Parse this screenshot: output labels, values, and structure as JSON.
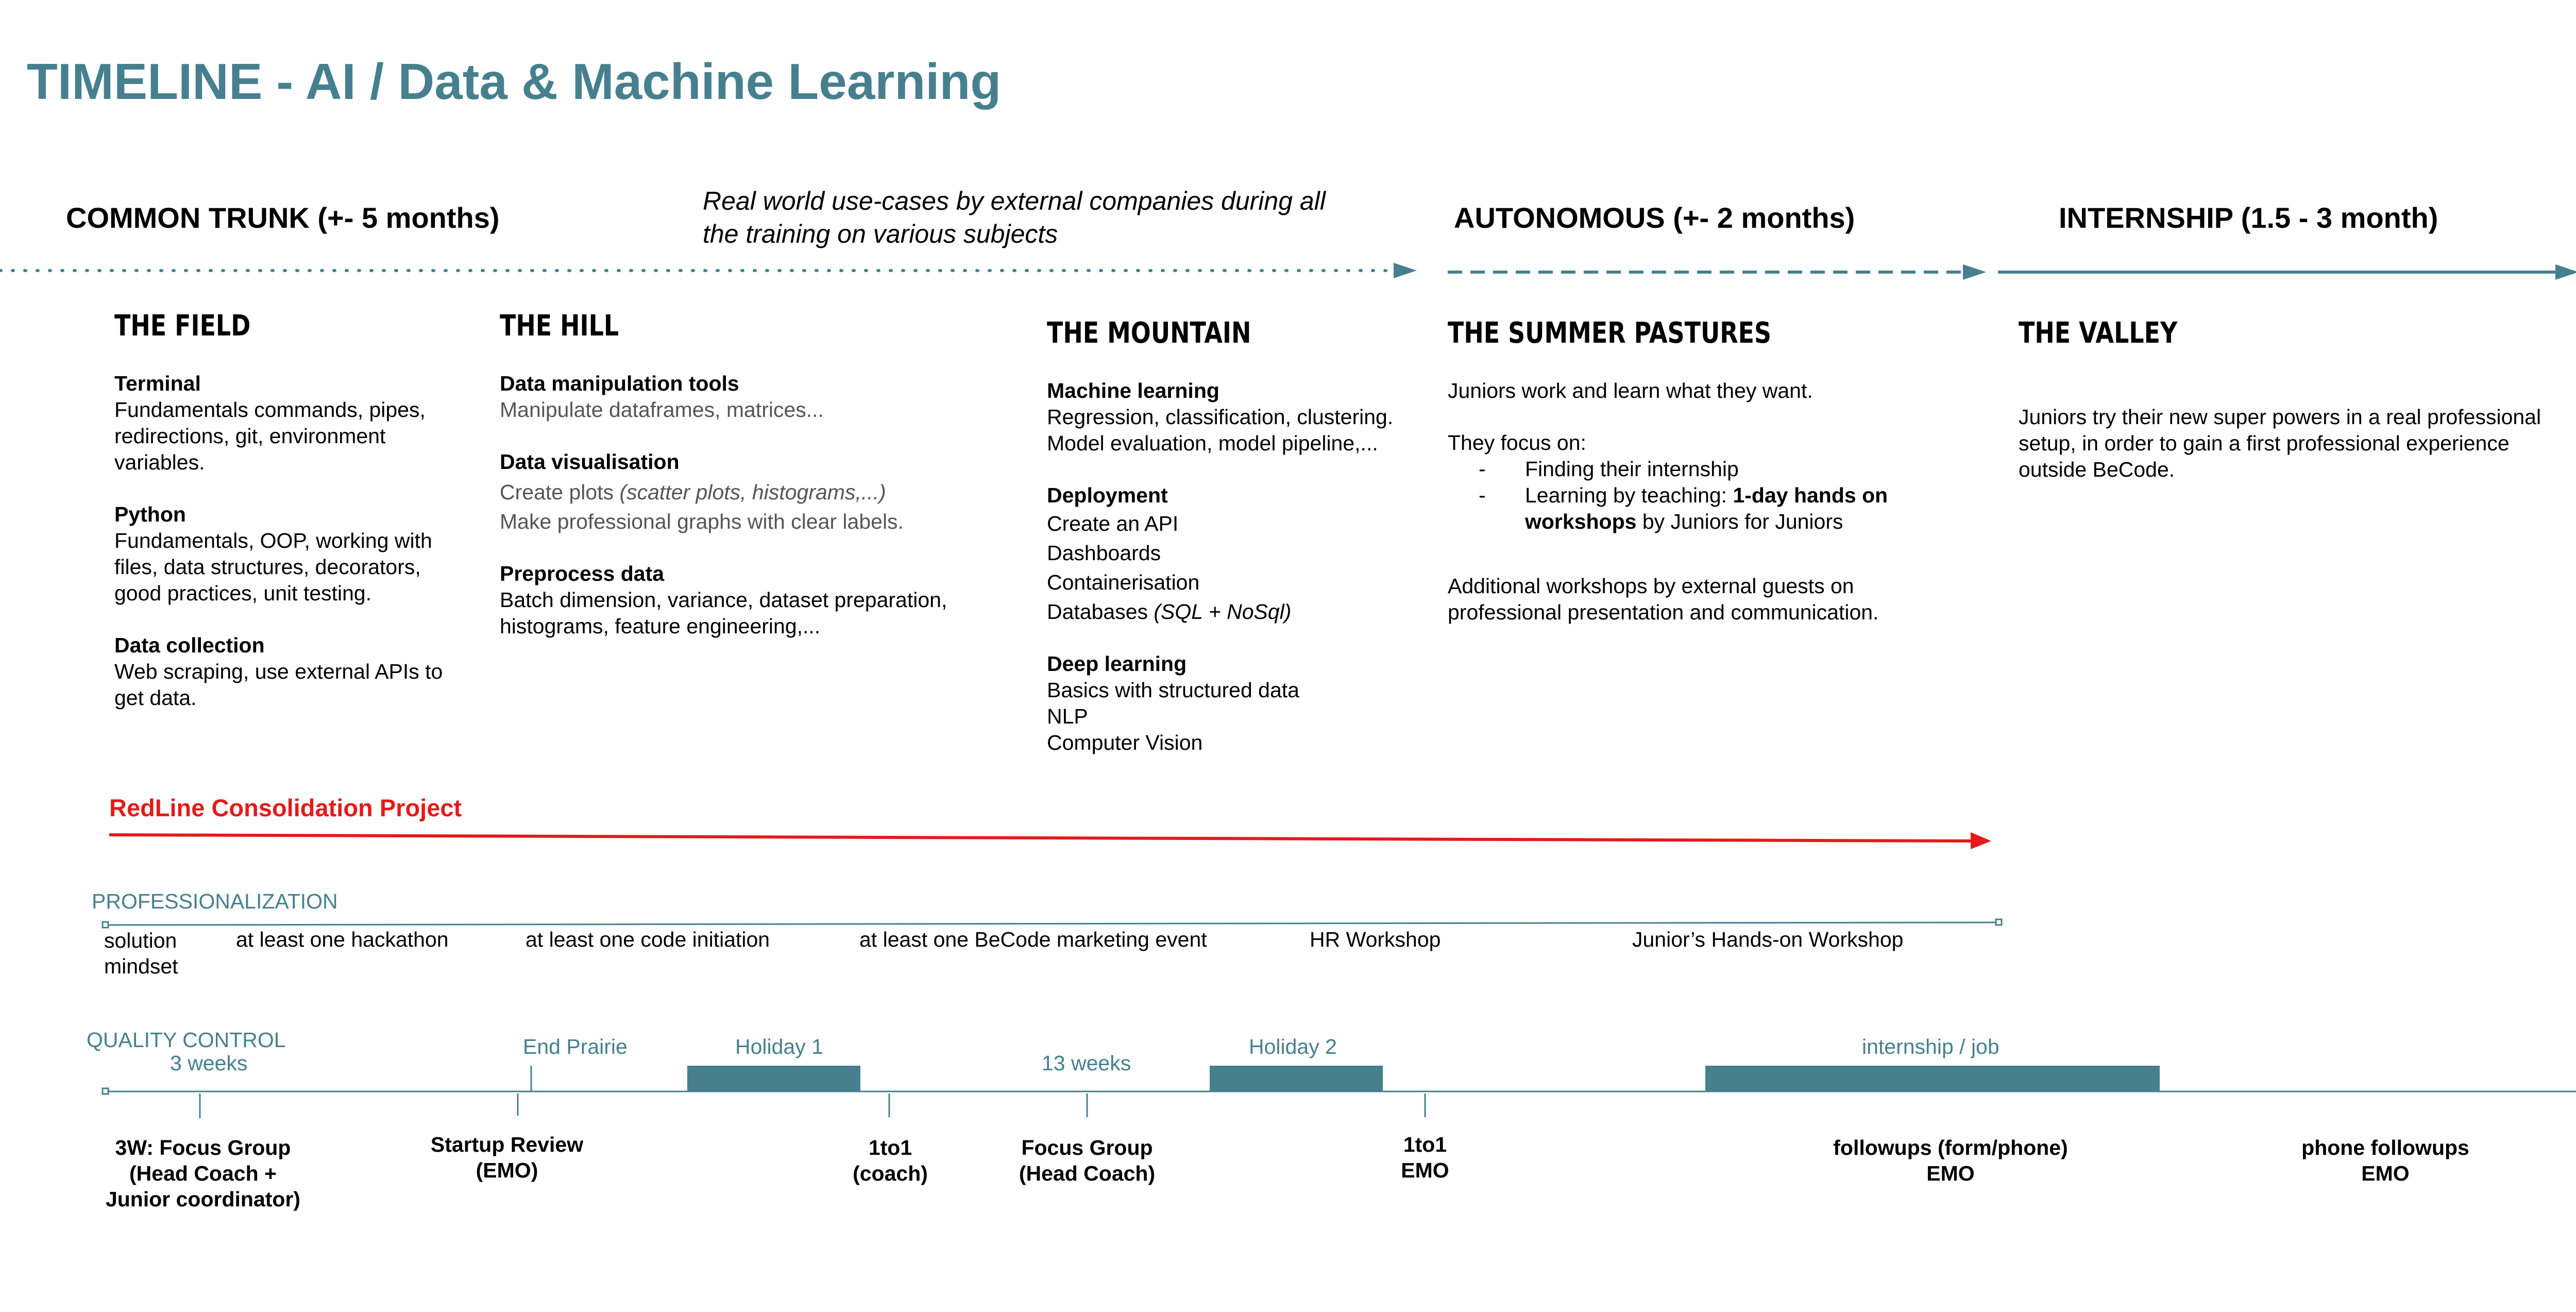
{
  "title": "TIMELINE - AI / Data & Machine Learning",
  "phases": {
    "common_trunk": "COMMON TRUNK (+- 5 months)",
    "use_cases_line1": "Real world use-cases by external companies during all",
    "use_cases_line2": "the training on various subjects",
    "autonomous": "AUTONOMOUS (+- 2 months)",
    "internship": "INTERNSHIP (1.5 - 3 month)"
  },
  "stages": {
    "field": {
      "title": "THE FIELD",
      "terminal_h": "Terminal",
      "terminal_1": "Fundamentals commands, pipes,",
      "terminal_2": "redirections, git, environment",
      "terminal_3": "variables.",
      "python_h": "Python",
      "python_1": "Fundamentals, OOP, working with",
      "python_2": "files, data structures, decorators,",
      "python_3": "good practices, unit testing.",
      "collect_h": "Data collection",
      "collect_1": "Web scraping, use external APIs to",
      "collect_2": "get data."
    },
    "hill": {
      "title": "THE HILL",
      "manip_h": "Data manipulation tools",
      "manip_1": "Manipulate dataframes, matrices...",
      "viz_h": "Data visualisation",
      "viz_1a": "Create plots ",
      "viz_1b": "(scatter plots, histograms,...)",
      "viz_2": "Make professional graphs with clear labels.",
      "pre_h": "Preprocess data",
      "pre_1": "Batch dimension, variance, dataset preparation,",
      "pre_2": "histograms, feature engineering,..."
    },
    "mountain": {
      "title": "THE MOUNTAIN",
      "ml_h": "Machine learning",
      "ml_1": "Regression, classification, clustering.",
      "ml_2": "Model evaluation, model pipeline,...",
      "dep_h": "Deployment",
      "dep_1": "Create an API",
      "dep_2": "Dashboards",
      "dep_3": "Containerisation",
      "dep_4a": "Databases ",
      "dep_4b": "(SQL + NoSql)",
      "dl_h": "Deep learning",
      "dl_1": "Basics with structured data",
      "dl_2": "NLP",
      "dl_3": "Computer Vision"
    },
    "summer": {
      "title": "THE SUMMER PASTURES",
      "p1": "Juniors work and learn what they want.",
      "p2": "They focus on:",
      "b1": "Finding their internship",
      "b2a": "Learning by teaching: ",
      "b2b": "1-day hands on",
      "b2c": "workshops",
      "b2d": " by Juniors for Juniors",
      "p3_1": "Additional workshops by external guests on",
      "p3_2": "professional presentation and communication.",
      "dash": "-"
    },
    "valley": {
      "title": "THE VALLEY",
      "p1_1": "Juniors try their new super powers in a real professional",
      "p1_2": "setup, in order to gain a first professional experience",
      "p1_3": "outside BeCode."
    }
  },
  "redline": "RedLine Consolidation Project",
  "professionalization": {
    "label": "PROFESSIONALIZATION",
    "items": {
      "solution_1": "solution",
      "solution_2": "mindset",
      "hackathon": "at least one hackathon",
      "code_init": "at least one code initiation",
      "marketing": "at least one BeCode marketing event",
      "hr": "HR Workshop",
      "handson": "Junior’s Hands-on  Workshop"
    }
  },
  "quality": {
    "label": "QUALITY CONTROL",
    "weeks3": "3 weeks",
    "end_prairie": "End Prairie",
    "holiday1": "Holiday 1",
    "weeks13": "13 weeks",
    "holiday2": "Holiday 2",
    "internship_job": "internship / job",
    "milestones": {
      "focus3w_1": "3W: Focus Group",
      "focus3w_2": "(Head Coach +",
      "focus3w_3": "Junior coordinator)",
      "startup_1": "Startup Review",
      "startup_2": "(EMO)",
      "oto1_1": "1to1",
      "oto1_2": "(coach)",
      "focus_1": "Focus Group",
      "focus_2": "(Head Coach)",
      "oto2_1": "1to1",
      "oto2_2": "EMO",
      "follow_1": "followups (form/phone)",
      "follow_2": "EMO",
      "phone_1": "phone followups",
      "phone_2": "EMO"
    }
  },
  "colors": {
    "teal": "#46808f",
    "red": "#e51a1a"
  }
}
